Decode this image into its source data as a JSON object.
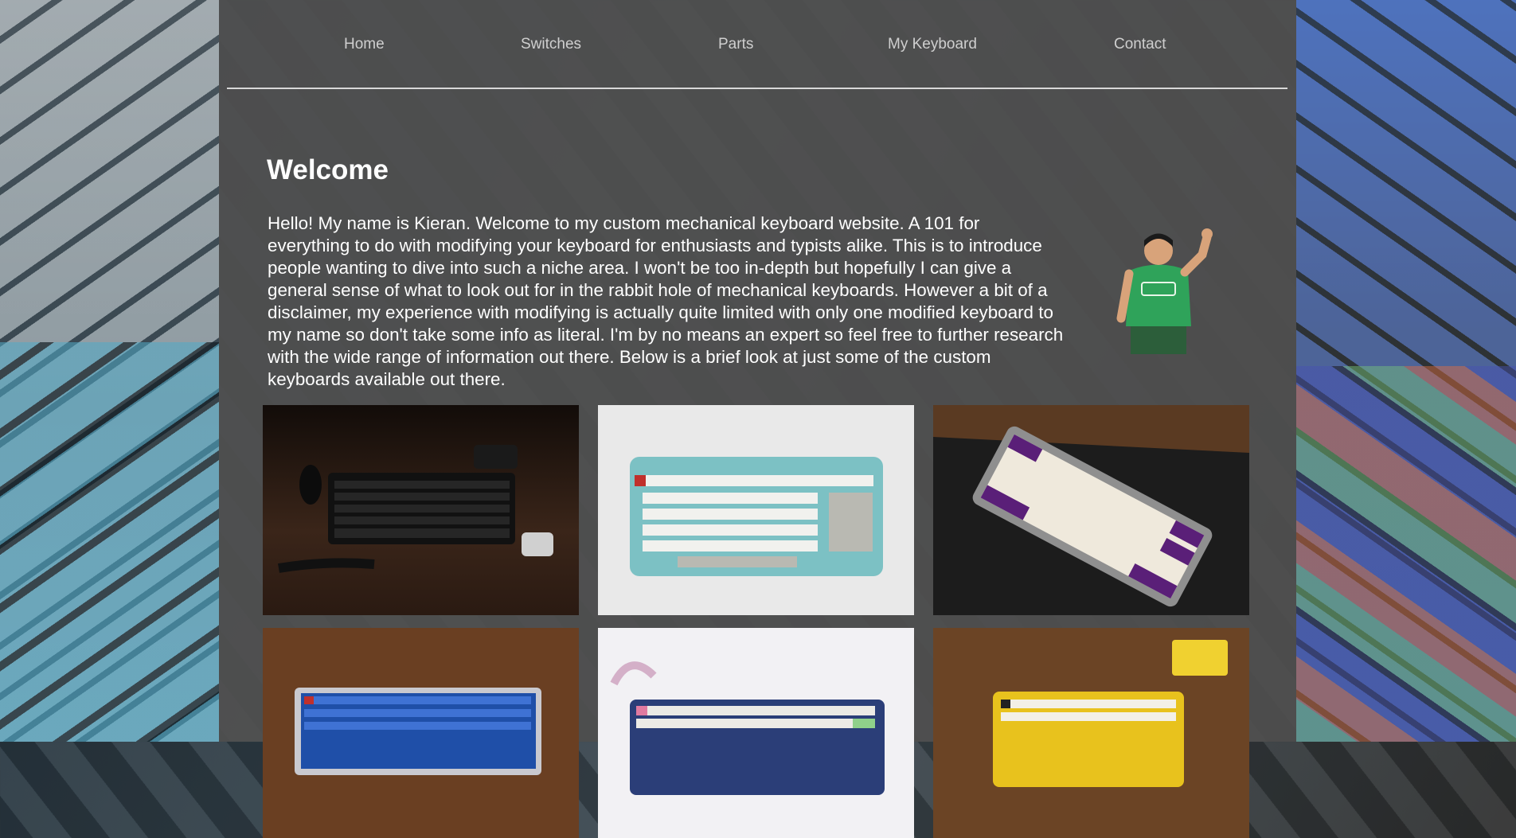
{
  "nav": {
    "items": [
      {
        "label": "Home"
      },
      {
        "label": "Switches"
      },
      {
        "label": "Parts"
      },
      {
        "label": "My Keyboard"
      },
      {
        "label": "Contact"
      }
    ]
  },
  "main": {
    "title": "Welcome",
    "intro": "Hello! My name is Kieran. Welcome to my custom mechanical keyboard website. A 101 for everything to do with modifying your keyboard for enthusiasts and typists alike. This is to introduce people wanting to dive into such a niche area. I won't be too in-depth but hopefully I can give a general sense of what to look out for in the rabbit hole of mechanical keyboards. However a bit of a disclaimer, my experience with modifying is actually quite limited with only one modified keyboard to my name so don't take some info as literal. I'm by no means an expert so feel free to further research with the wide range of information out there. Below is a brief look at just some of the custom keyboards available out there."
  },
  "colors": {
    "panel": "#505050",
    "text": "#ffffff",
    "nav_text": "#cfcfcf"
  },
  "gallery": {
    "images": [
      {
        "subject": "black-tkl-keyboard-on-wood-desk"
      },
      {
        "subject": "teal-keyboard-white-keycaps"
      },
      {
        "subject": "purple-white-keyboard-on-deskmat"
      },
      {
        "subject": "blue-keyboard-on-wood"
      },
      {
        "subject": "white-keyboard-coiled-cable"
      },
      {
        "subject": "yellow-keyboard-on-wood"
      }
    ]
  }
}
